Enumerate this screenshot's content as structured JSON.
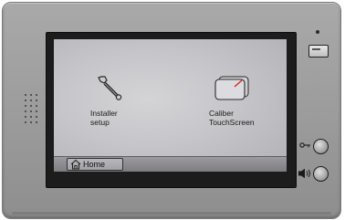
{
  "screen": {
    "apps": [
      {
        "label": "Installer\nsetup",
        "icon": "wrench-icon"
      },
      {
        "label": "Caliber\nTouchScreen",
        "icon": "touchscreen-icon"
      }
    ]
  },
  "taskbar": {
    "home_label": "Home",
    "home_icon": "home-icon"
  },
  "hardware": {
    "unlock_icon": "key-icon",
    "talk_icon": "talk-speaker-icon"
  },
  "colors": {
    "device_body": "#9b9b9b",
    "bezel": "#1c1c1c",
    "screen_bg": "#c6c5c9",
    "accent_red": "#d42020"
  }
}
